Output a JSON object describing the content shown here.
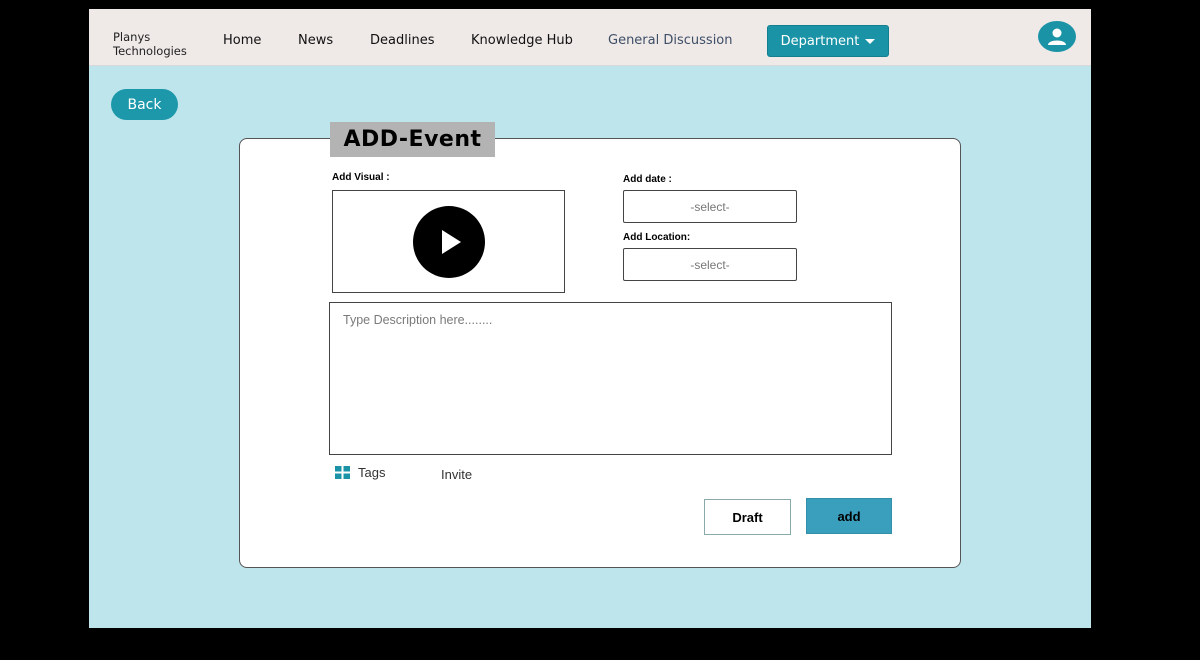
{
  "navbar": {
    "brand_line1": "Planys",
    "brand_line2": "Technologies",
    "links": [
      "Home",
      "News",
      "Deadlines",
      "Knowledge Hub",
      "General Discussion"
    ],
    "department_label": "Department",
    "user_icon": "user-icon"
  },
  "back_label": "Back",
  "form": {
    "title": "ADD-Event",
    "add_visual_label": "Add Visual :",
    "add_date_label": "Add date :",
    "add_location_label": "Add Location:",
    "date_value": "-select-",
    "location_value": "-select-",
    "description_placeholder": "Type  Description here........",
    "tags_label": "Tags",
    "invite_label": "Invite",
    "draft_label": "Draft",
    "add_label": "add"
  },
  "colors": {
    "background": "#bfe5ec",
    "navbar": "#efe9e8",
    "accent": "#1a93a6",
    "add_button": "#3a9fbd",
    "title_bar": "#b3b3b3"
  }
}
